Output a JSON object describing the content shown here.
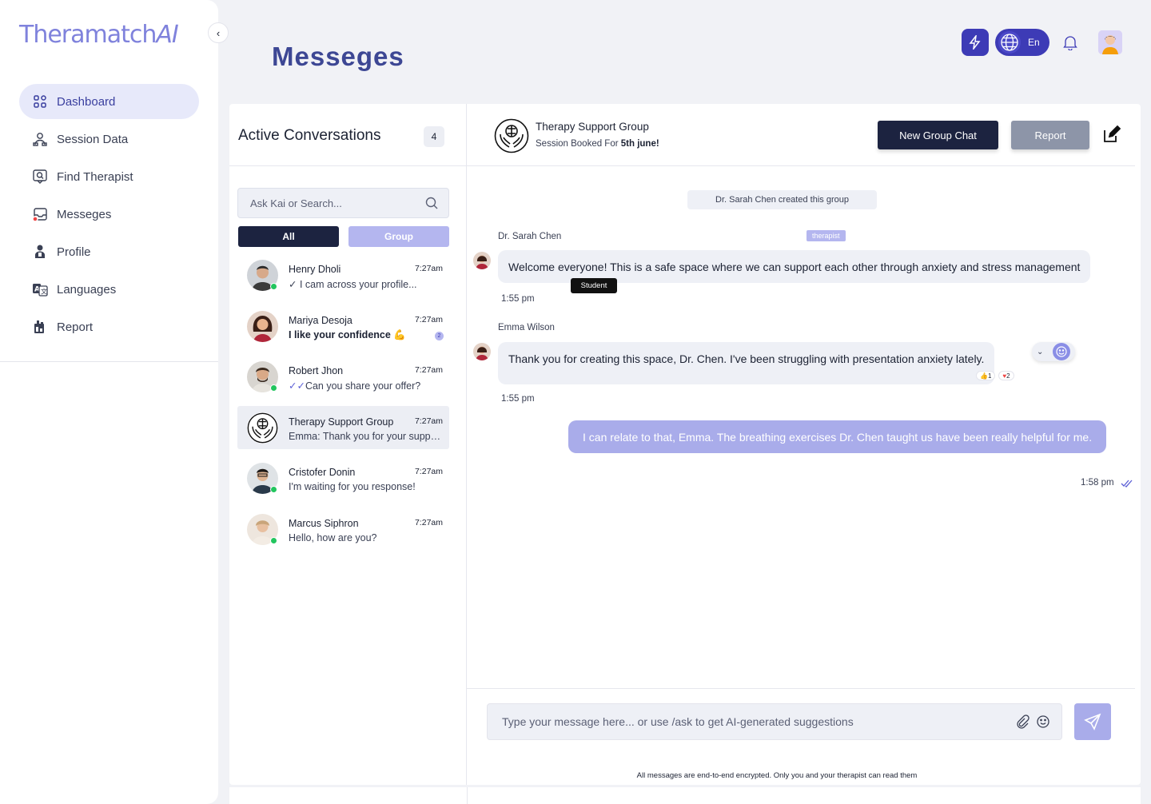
{
  "app": {
    "logo_main": "Theramatch",
    "logo_ai": "AI"
  },
  "sidebar": {
    "items": [
      {
        "label": "Dashboard",
        "icon": "dashboard-icon",
        "active": true
      },
      {
        "label": "Session Data",
        "icon": "session-icon"
      },
      {
        "label": "Find Therapist",
        "icon": "find-icon"
      },
      {
        "label": "Messeges",
        "icon": "inbox-icon"
      },
      {
        "label": "Profile",
        "icon": "profile-icon"
      },
      {
        "label": "Languages",
        "icon": "languages-icon"
      },
      {
        "label": "Report",
        "icon": "report-icon"
      }
    ]
  },
  "header": {
    "title": "Messeges",
    "language": "En"
  },
  "conversations": {
    "title": "Active Conversations",
    "count": "4",
    "search_placeholder": "Ask Kai or Search...",
    "tab_all": "All",
    "tab_group": "Group",
    "items": [
      {
        "name": "Henry Dholi",
        "time": "7:27am",
        "preview": "I cam across your profile..."
      },
      {
        "name": "Mariya Desoja",
        "time": "7:27am",
        "preview": "I like your confidence 💪",
        "unread": "2"
      },
      {
        "name": "Robert Jhon",
        "time": "7:27am",
        "preview": "Can you share your offer?"
      },
      {
        "name": "Therapy Support Group",
        "time": "7:27am",
        "preview": "Emma: Thank you for your support..."
      },
      {
        "name": "Cristofer Donin",
        "time": "7:27am",
        "preview": "I'm waiting for you response!"
      },
      {
        "name": "Marcus Siphron",
        "time": "7:27am",
        "preview": "Hello, how are you?"
      }
    ]
  },
  "chat": {
    "group_name": "Therapy Support Group",
    "session_prefix": "Session Booked For ",
    "session_date": "5th june!",
    "new_group_label": "New Group Chat",
    "report_label": "Report",
    "system_message": "Dr. Sarah Chen created this group",
    "messages": [
      {
        "sender": "Dr. Sarah Chen",
        "badge": "therapist",
        "text": "Welcome everyone! This is a safe space where we can support each other through anxiety and stress management",
        "time": "1:55 pm",
        "tooltip": "Student"
      },
      {
        "sender": "Emma Wilson",
        "text": "Thank you for creating this space, Dr. Chen. I've been struggling with presentation anxiety lately.",
        "time": "1:55 pm",
        "reactions": [
          "1",
          "2"
        ]
      },
      {
        "text": "I can relate to that, Emma. The breathing exercises Dr. Chen taught us have been really helpful for me.",
        "time": "1:58 pm"
      }
    ],
    "composer_placeholder": "Type your message here... or use /ask to get AI-generated suggestions",
    "encryption_note": "All messages are end-to-end encrypted. Only you and your therapist can read them"
  },
  "colors": {
    "accent": "#3d3bb6",
    "accent_light": "#a9acea",
    "dark_navy": "#1c2340",
    "online": "#22c55e"
  }
}
